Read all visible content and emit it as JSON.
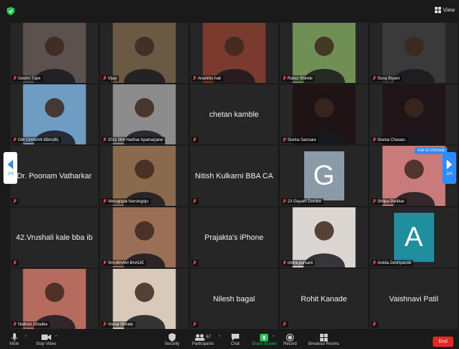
{
  "topbar": {
    "view_label": "View",
    "shield_color": "#23c552"
  },
  "navigation": {
    "prev_page": "2/4",
    "next_page": "2/4"
  },
  "tooltip": {
    "label": "Ask to Unmute"
  },
  "participants": [
    {
      "name": "Geshri Tupe",
      "video": true,
      "scene": "#5b5250"
    },
    {
      "name": "Vijay",
      "video": true,
      "scene": "#6a5a44"
    },
    {
      "name": "Ananthu nair",
      "video": true,
      "scene": "#7a3a2e"
    },
    {
      "name": "Rahul Shinde",
      "video": true,
      "scene": "#6f8f55"
    },
    {
      "name": "Suraj Biyani",
      "video": true,
      "scene": "#3a3a3a"
    },
    {
      "name": "OM CHAVAN BBA(IB)",
      "video": true,
      "scene": "#6f9cc2"
    },
    {
      "name": "2011 004 Harihar Apamarjane",
      "video": true,
      "scene": "#8c8c8c"
    },
    {
      "name": "chetan kamble",
      "video": false
    },
    {
      "name": "Sneha Sansare",
      "video": true,
      "scene": "#1e1416"
    },
    {
      "name": "Sneha Chavan.",
      "video": true,
      "scene": "#1f1418"
    },
    {
      "name": "Dr. Poonam Vatharkar",
      "video": false
    },
    {
      "name": "Venugopal Narsingoju",
      "video": true,
      "scene": "#8a6a4c"
    },
    {
      "name": "Nitish Kulkarni BBA CA",
      "video": false
    },
    {
      "name": "23 Gayatri Dombe",
      "video": false,
      "avatar_letter": "G",
      "avatar_color": "#8a9aa6"
    },
    {
      "name": "Shilpa Parlikar",
      "video": true,
      "scene": "#c97a7a"
    },
    {
      "name": "42.Vrushali kale bba ib",
      "video": false
    },
    {
      "name": "SHUBHAM BHADE",
      "video": true,
      "scene": "#9a6f55"
    },
    {
      "name": "Prajakta's iPhone",
      "video": false
    },
    {
      "name": "chitra purvant",
      "video": true,
      "scene": "#dcd6d2"
    },
    {
      "name": "Ankita Deshpande",
      "video": false,
      "avatar_letter": "A",
      "avatar_color": "#1f8fa0"
    },
    {
      "name": "Nidhish Ghodke",
      "video": true,
      "scene": "#b56b5e"
    },
    {
      "name": "Vishal Shinde",
      "video": true,
      "scene": "#d8c9b8"
    },
    {
      "name": "Nilesh bagal",
      "video": false
    },
    {
      "name": "Rohit Kanade",
      "video": false
    },
    {
      "name": "Vaishnavi Patil",
      "video": false
    }
  ],
  "toolbar": {
    "mute": "Mute",
    "stop_video": "Stop Video",
    "security": "Security",
    "participants_label": "Participants",
    "participants_count": "67",
    "chat": "Chat",
    "share_screen": "Share Screen",
    "record": "Record",
    "breakout_rooms": "Breakout Rooms",
    "end": "End",
    "share_color": "#23c552",
    "end_color": "#e02828"
  }
}
